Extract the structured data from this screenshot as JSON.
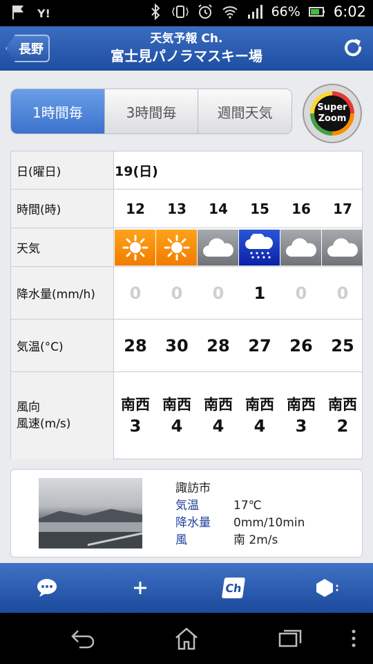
{
  "status_bar": {
    "battery": "66%",
    "time": "6:02",
    "icons": [
      "flag-icon",
      "yahoo-icon",
      "bluetooth-icon",
      "vibrate-icon",
      "alarm-icon",
      "wifi-icon",
      "signal-icon",
      "battery-icon"
    ]
  },
  "header": {
    "back_label": "長野",
    "subtitle": "天気予報 Ch.",
    "title": "富士見パノラマスキー場"
  },
  "tabs": [
    {
      "label": "1時間毎",
      "active": true
    },
    {
      "label": "3時間毎",
      "active": false
    },
    {
      "label": "週間天気",
      "active": false
    }
  ],
  "super_zoom": {
    "line1": "Super",
    "line2": "Zoom"
  },
  "table": {
    "labels": {
      "date": "日(曜日)",
      "hour": "時間(時)",
      "weather": "天気",
      "precip": "降水量(mm/h)",
      "temp": "気温(°C)",
      "wind_dir": "風向",
      "wind_speed": "風速(m/s)"
    },
    "date_value": "19(日)",
    "hours": [
      "12",
      "13",
      "14",
      "15",
      "16",
      "17"
    ],
    "weather": [
      "sunny",
      "sunny",
      "cloudy",
      "rain",
      "cloudy",
      "cloudy"
    ],
    "precip": [
      "0",
      "0",
      "0",
      "1",
      "0",
      "0"
    ],
    "temps": [
      "28",
      "30",
      "28",
      "27",
      "26",
      "25"
    ],
    "wind_dirs": [
      "南西",
      "南西",
      "南西",
      "南西",
      "南西",
      "南西"
    ],
    "wind_speeds": [
      "3",
      "4",
      "4",
      "4",
      "3",
      "2"
    ],
    "colors": {
      "precip_zero": "#cfcfcf",
      "precip_nonzero": "#111111"
    }
  },
  "webcam": {
    "city": "諏訪市",
    "rows": [
      {
        "key": "気温",
        "value": "17℃"
      },
      {
        "key": "降水量",
        "value": "0mm/10min"
      },
      {
        "key": "風",
        "value": "南 2m/s"
      }
    ]
  },
  "toolbar": {
    "buttons": [
      "comment-icon",
      "plus-icon",
      "channel-icon",
      "settings-icon"
    ],
    "channel_label": "Ch"
  }
}
